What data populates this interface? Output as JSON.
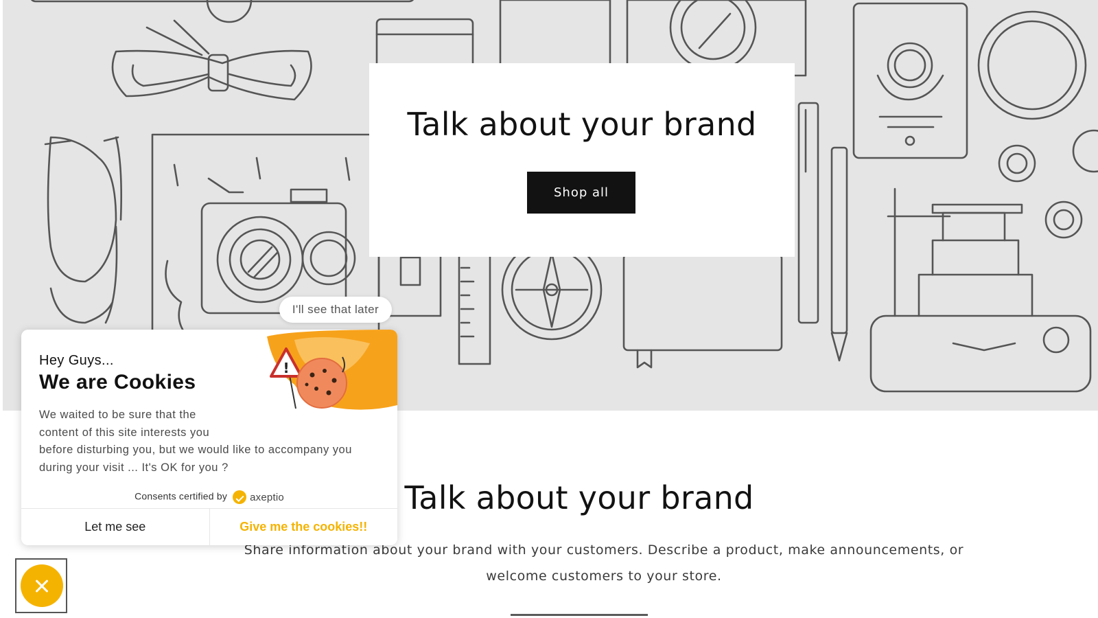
{
  "hero": {
    "title": "Talk about your brand",
    "button_label": "Shop all",
    "background_color": "#e5e5e5"
  },
  "section": {
    "title": "Talk about your brand",
    "description": "Share information about your brand with your customers. Describe a product, make announcements, or welcome customers to your store."
  },
  "cookie_popup": {
    "later_label": "I'll see that later",
    "greeting": "Hey Guys...",
    "title": "We are Cookies",
    "body": "We waited to be sure that the\ncontent of this site interests you\nbefore disturbing you, but we would like to accompany you\nduring your visit ... It's OK for you ?",
    "certified_label": "Consents certified by",
    "brand_name": "axeptio",
    "deny_label": "Let me see",
    "accept_label": "Give me the cookies!!",
    "accent_color": "#f5b301",
    "close_icon": "close-icon"
  }
}
